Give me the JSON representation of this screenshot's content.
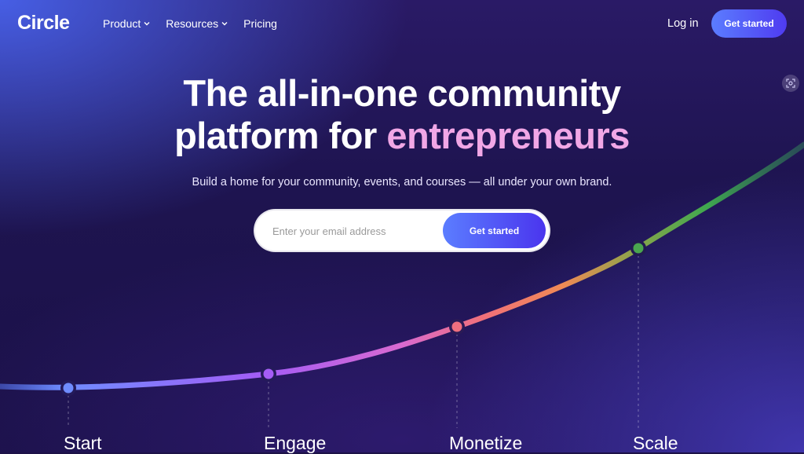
{
  "header": {
    "logo": "Circle",
    "nav": [
      {
        "label": "Product",
        "has_dropdown": true
      },
      {
        "label": "Resources",
        "has_dropdown": true
      },
      {
        "label": "Pricing",
        "has_dropdown": false
      }
    ],
    "login_label": "Log in",
    "cta_label": "Get started"
  },
  "hero": {
    "title_line1": "The all-in-one community",
    "title_line2_prefix": "platform for ",
    "title_line2_accent": "entrepreneurs",
    "subtitle": "Build a home for your community, events, and courses — all under your own brand.",
    "email_placeholder": "Enter your email address",
    "cta_label": "Get started"
  },
  "stages": [
    {
      "label": "Start",
      "color": "#6f8cff"
    },
    {
      "label": "Engage",
      "color": "#a45cf5"
    },
    {
      "label": "Monetize",
      "color": "#ef6f7f"
    },
    {
      "label": "Scale",
      "color": "#4aa64f"
    }
  ],
  "colors": {
    "accent_pink": "#f1a7e6",
    "button_start": "#5b7dff",
    "button_end": "#4f3bf0"
  }
}
